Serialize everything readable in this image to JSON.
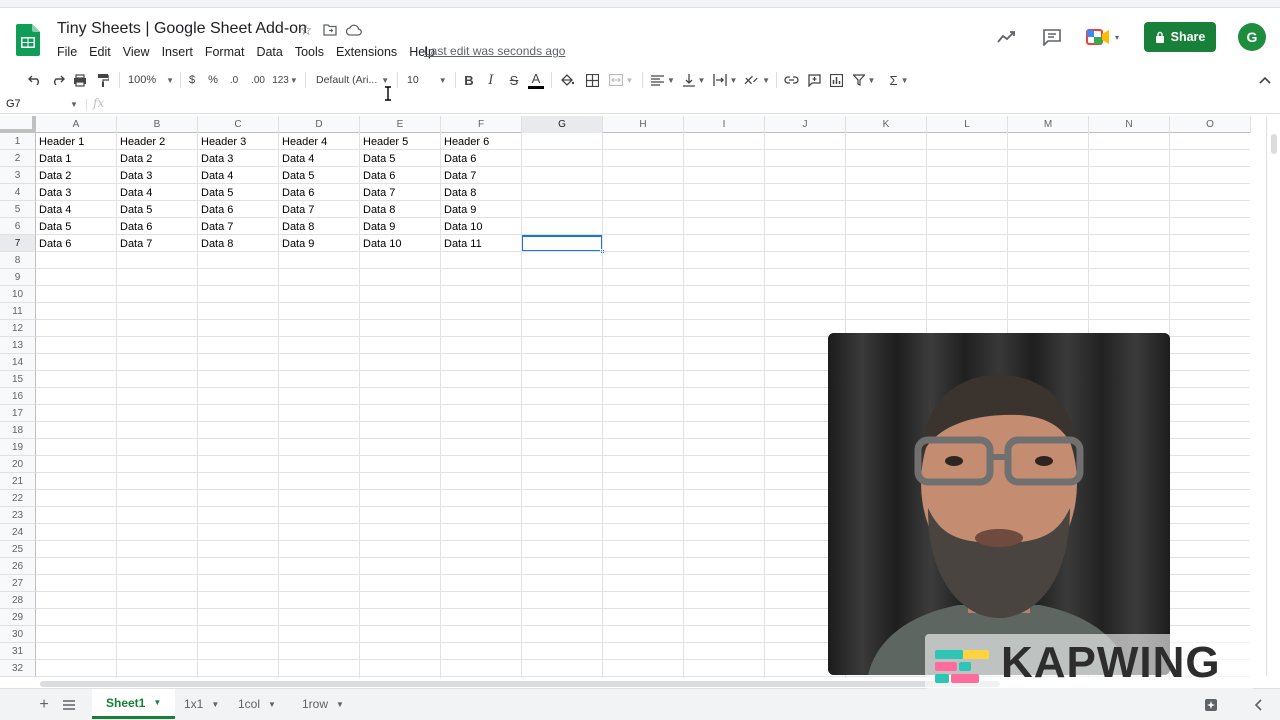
{
  "app": {
    "title": "Tiny Sheets | Google Sheet Add-on",
    "last_edit": "Last edit was seconds ago",
    "share_label": "Share",
    "avatar_initial": "G",
    "brand_color": "#188038"
  },
  "menu": [
    "File",
    "Edit",
    "View",
    "Insert",
    "Format",
    "Data",
    "Tools",
    "Extensions",
    "Help"
  ],
  "toolbar": {
    "zoom": "100%",
    "currency": "$",
    "percent": "%",
    "decrease_decimal": ".0",
    "increase_decimal": ".00",
    "more_formats": "123",
    "font": "Default (Ari...",
    "font_size": "10",
    "bold": "B",
    "italic": "I",
    "strike": "S",
    "text_color": "A",
    "sum": "Σ"
  },
  "formula_bar": {
    "name_box": "G7",
    "fx": "fx",
    "value": ""
  },
  "columns": [
    "A",
    "B",
    "C",
    "D",
    "E",
    "F",
    "G",
    "H",
    "I",
    "J",
    "K",
    "L",
    "M",
    "N",
    "O"
  ],
  "selected_column": "G",
  "rows": [
    "1",
    "2",
    "3",
    "4",
    "5",
    "6",
    "7",
    "8",
    "9",
    "10",
    "11",
    "12",
    "13",
    "14",
    "15",
    "16",
    "17",
    "18",
    "19",
    "20",
    "21",
    "22",
    "23",
    "24",
    "25",
    "26",
    "27",
    "28",
    "29",
    "30",
    "31",
    "32"
  ],
  "selected_row": "7",
  "cells": [
    [
      "Header 1",
      "Header 2",
      "Header 3",
      "Header 4",
      "Header 5",
      "Header 6"
    ],
    [
      "Data 1",
      "Data 2",
      "Data 3",
      "Data 4",
      "Data 5",
      "Data 6"
    ],
    [
      "Data 2",
      "Data 3",
      "Data 4",
      "Data 5",
      "Data 6",
      "Data 7"
    ],
    [
      "Data 3",
      "Data 4",
      "Data 5",
      "Data 6",
      "Data 7",
      "Data 8"
    ],
    [
      "Data 4",
      "Data 5",
      "Data 6",
      "Data 7",
      "Data 8",
      "Data 9"
    ],
    [
      "Data 5",
      "Data 6",
      "Data 7",
      "Data 8",
      "Data 9",
      "Data 10"
    ],
    [
      "Data 6",
      "Data 7",
      "Data 8",
      "Data 9",
      "Data 10",
      "Data 11"
    ]
  ],
  "sheets": [
    {
      "name": "Sheet1",
      "active": true
    },
    {
      "name": "1x1",
      "active": false
    },
    {
      "name": "1col",
      "active": false
    },
    {
      "name": "1row",
      "active": false
    }
  ],
  "watermark": "KAPWING"
}
